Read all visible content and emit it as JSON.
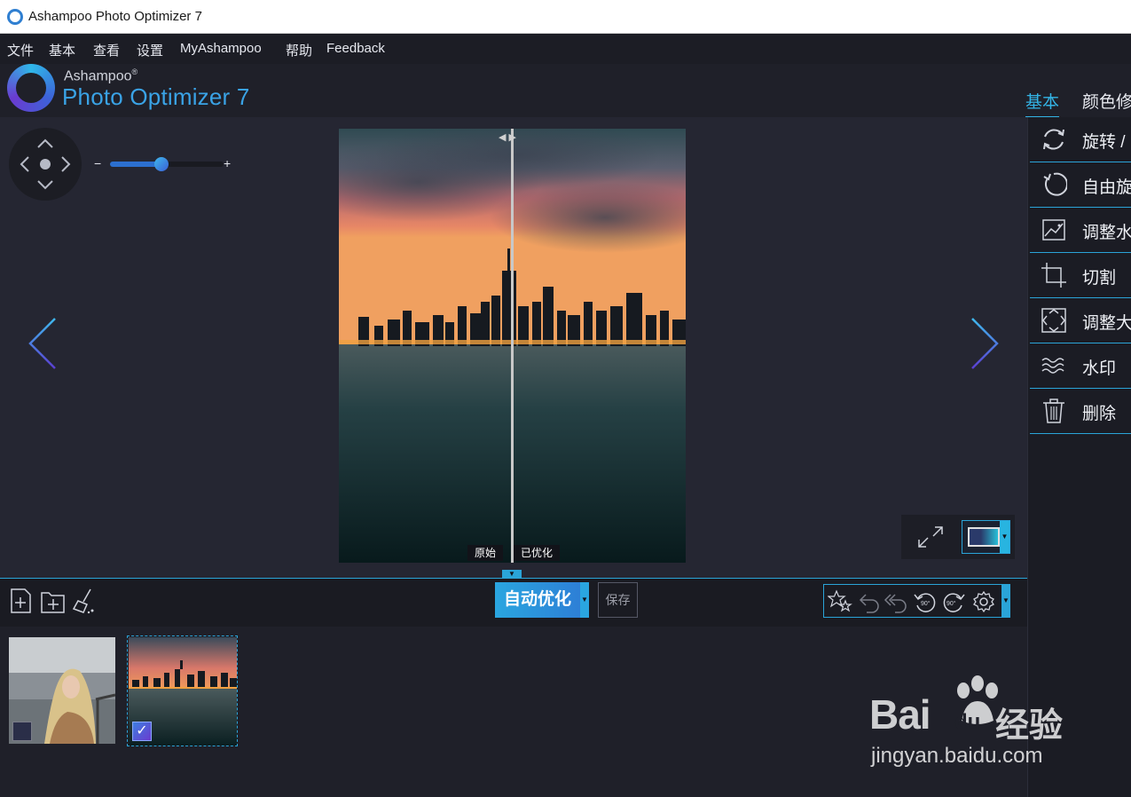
{
  "window": {
    "title": "Ashampoo Photo Optimizer 7"
  },
  "menu": [
    "文件",
    "基本",
    "查看",
    "设置",
    "MyAshampoo",
    "帮助",
    "Feedback"
  ],
  "logo": {
    "brand": "Ashampoo",
    "reg": "®",
    "product": "Photo Optimizer 7"
  },
  "right_tabs": {
    "active": "基本",
    "second": "颜色修"
  },
  "zoom": {
    "minus": "−",
    "plus": "+",
    "level": 0.45
  },
  "compare": {
    "original_label": "原始",
    "optimized_label": "已优化",
    "split_arrows": "◀ ▶"
  },
  "toolbar": {
    "auto_optimize": "自动优化",
    "save": "保存",
    "dropdown": "▼"
  },
  "side_tools": [
    {
      "label": "旋转 /",
      "icon": "rotate-icon"
    },
    {
      "label": "自由旋",
      "icon": "free-rotate-icon"
    },
    {
      "label": "调整水",
      "icon": "level-horizon-icon"
    },
    {
      "label": "切割",
      "icon": "crop-icon"
    },
    {
      "label": "调整大",
      "icon": "resize-icon"
    },
    {
      "label": "水印",
      "icon": "watermark-icon"
    },
    {
      "label": "删除",
      "icon": "trash-icon"
    }
  ],
  "thumbnails": [
    {
      "name": "woman-portrait",
      "selected": false
    },
    {
      "name": "city-sunset",
      "selected": true,
      "check": "✓"
    }
  ],
  "watermark": {
    "main": "Bai",
    "du": "du",
    "cn": "经验",
    "url": "jingyan.baidu.com"
  },
  "colors": {
    "accent": "#2aa4d8",
    "bg": "#1f2029",
    "panel": "#252632"
  }
}
